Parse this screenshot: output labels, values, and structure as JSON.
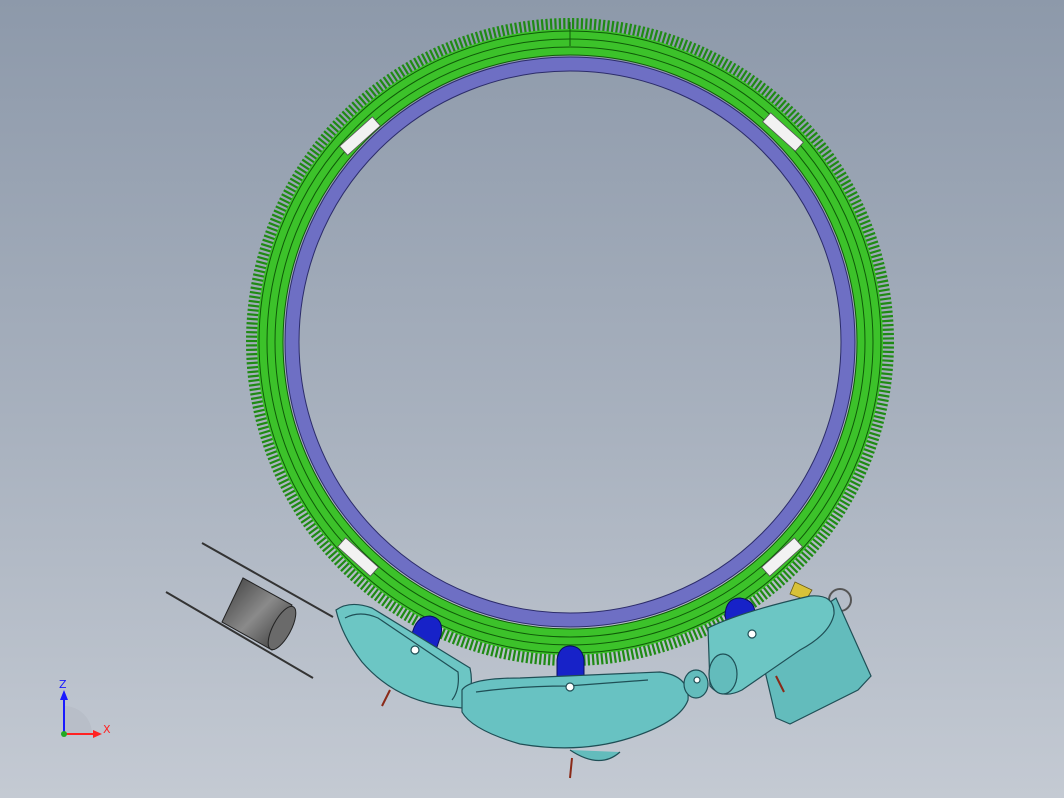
{
  "colors": {
    "background_top": "#8d99aa",
    "background_bottom": "#c4cad3",
    "gear_ring": "#33bb22",
    "inner_ring": "#6e6fc4",
    "carriage": "#63bcbc",
    "roller": "#1722c8",
    "spool": "#555555",
    "axis_z": "#1a1aff",
    "axis_x": "#ff2222",
    "axis_y": "#22aa22"
  },
  "triad": {
    "z_label": "Z",
    "x_label": "X"
  }
}
